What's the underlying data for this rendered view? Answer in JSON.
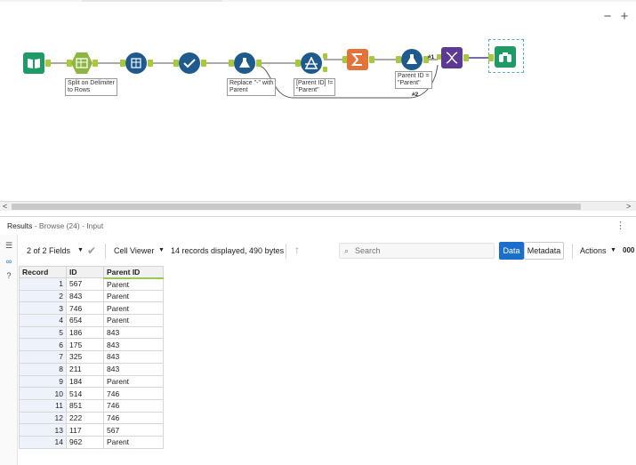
{
  "canvas": {
    "zoom_out": "−",
    "zoom_in": "+",
    "tools": [
      {
        "name": "input-data-tool",
        "color": "#1e9b67"
      },
      {
        "name": "text-to-columns-tool",
        "color": "#8cb63f"
      },
      {
        "name": "transpose-tool",
        "color": "#1f5a8f"
      },
      {
        "name": "select-tool",
        "color": "#1f5a8f"
      },
      {
        "name": "formula-replace-tool",
        "color": "#1f5a8f"
      },
      {
        "name": "filter-tool",
        "color": "#1f5a8f"
      },
      {
        "name": "summarize-tool",
        "color": "#e2733b"
      },
      {
        "name": "formula-parent-tool",
        "color": "#1f5a8f"
      },
      {
        "name": "join-tool",
        "color": "#5c3a94"
      },
      {
        "name": "browse-tool",
        "color": "#1e9b67"
      }
    ],
    "labels": {
      "split": "Split on Delimiter\nto Rows",
      "replace": "Replace \"-\" with\nParent",
      "filter": "[Parent ID] !=\n\"Parent\"",
      "parent": "Parent ID =\n\"Parent\""
    },
    "anchor_1": "#1",
    "anchor_2": "#2"
  },
  "results": {
    "title": "Results",
    "subtitle": " - Browse (24) - Input",
    "menu_icon": "⋮",
    "fields_selector": "2 of 2 Fields",
    "cell_viewer": "Cell Viewer",
    "records_info": "14 records displayed, 490 bytes",
    "search_placeholder": "Search",
    "data_tab": "Data",
    "metadata_tab": "Metadata",
    "actions": "Actions",
    "more": "000"
  },
  "table": {
    "headers": [
      "Record",
      "ID",
      "Parent ID"
    ],
    "rows": [
      [
        "1",
        "567",
        "Parent"
      ],
      [
        "2",
        "843",
        "Parent"
      ],
      [
        "3",
        "746",
        "Parent"
      ],
      [
        "4",
        "654",
        "Parent"
      ],
      [
        "5",
        "186",
        "843"
      ],
      [
        "6",
        "175",
        "843"
      ],
      [
        "7",
        "325",
        "843"
      ],
      [
        "8",
        "211",
        "843"
      ],
      [
        "9",
        "184",
        "Parent"
      ],
      [
        "10",
        "514",
        "746"
      ],
      [
        "11",
        "851",
        "746"
      ],
      [
        "12",
        "222",
        "746"
      ],
      [
        "13",
        "117",
        "567"
      ],
      [
        "14",
        "962",
        "Parent"
      ]
    ]
  }
}
